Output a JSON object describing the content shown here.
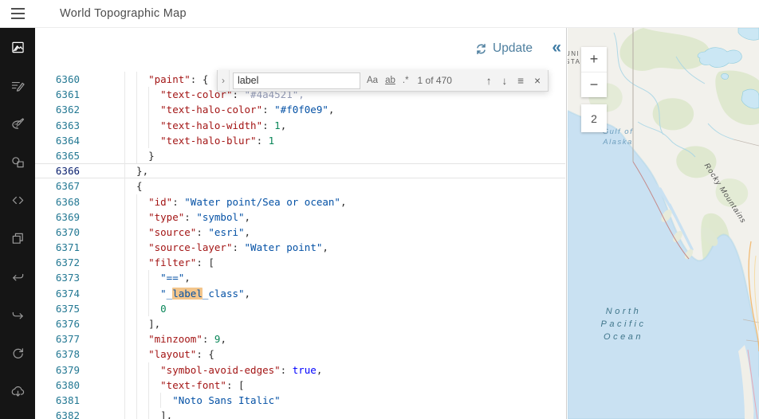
{
  "header": {
    "title": "World Topographic Map"
  },
  "sidebar": {
    "items": [
      {
        "icon": "layer-style-icon",
        "active": true
      },
      {
        "icon": "edit-labels-icon",
        "active": false
      },
      {
        "icon": "edit-colors-icon",
        "active": false
      },
      {
        "icon": "edit-symbols-icon",
        "active": false
      },
      {
        "icon": "edit-json-icon",
        "active": false
      },
      {
        "icon": "duplicate-icon",
        "active": false
      },
      {
        "icon": "undo-icon",
        "active": false
      },
      {
        "icon": "redo-icon",
        "active": false
      },
      {
        "icon": "reset-icon",
        "active": false
      },
      {
        "icon": "download-icon",
        "active": false
      }
    ]
  },
  "editor": {
    "toolbar": {
      "update_label": "Update",
      "collapse_icon": "«"
    },
    "find": {
      "expand_icon": "›",
      "query": "label",
      "match_case": "Aa",
      "whole_word": "ab",
      "regex": ".*",
      "results": "1 of 470",
      "prev_icon": "↑",
      "next_icon": "↓",
      "in_selection_icon": "≡",
      "close_icon": "×"
    },
    "code": {
      "current_line": 6366,
      "lines": [
        {
          "n": 6360,
          "tokens": [
            {
              "t": "    ",
              "c": "p"
            },
            {
              "t": "\"paint\"",
              "c": "k"
            },
            {
              "t": ": {",
              "c": "p"
            }
          ]
        },
        {
          "n": 6361,
          "tokens": [
            {
              "t": "      ",
              "c": "p"
            },
            {
              "t": "\"text-color\"",
              "c": "k"
            },
            {
              "t": ": ",
              "c": "p"
            },
            {
              "t": "\"#4a4521\",",
              "c": "d"
            }
          ]
        },
        {
          "n": 6362,
          "tokens": [
            {
              "t": "      ",
              "c": "p"
            },
            {
              "t": "\"text-halo-color\"",
              "c": "k"
            },
            {
              "t": ": ",
              "c": "p"
            },
            {
              "t": "\"#f0f0e9\"",
              "c": "s"
            },
            {
              "t": ",",
              "c": "p"
            }
          ]
        },
        {
          "n": 6363,
          "tokens": [
            {
              "t": "      ",
              "c": "p"
            },
            {
              "t": "\"text-halo-width\"",
              "c": "k"
            },
            {
              "t": ": ",
              "c": "p"
            },
            {
              "t": "1",
              "c": "n"
            },
            {
              "t": ",",
              "c": "p"
            }
          ]
        },
        {
          "n": 6364,
          "tokens": [
            {
              "t": "      ",
              "c": "p"
            },
            {
              "t": "\"text-halo-blur\"",
              "c": "k"
            },
            {
              "t": ": ",
              "c": "p"
            },
            {
              "t": "1",
              "c": "n"
            }
          ]
        },
        {
          "n": 6365,
          "tokens": [
            {
              "t": "    }",
              "c": "p"
            }
          ]
        },
        {
          "n": 6366,
          "tokens": [
            {
              "t": "  },",
              "c": "p"
            }
          ]
        },
        {
          "n": 6367,
          "tokens": [
            {
              "t": "  {",
              "c": "p"
            }
          ]
        },
        {
          "n": 6368,
          "tokens": [
            {
              "t": "    ",
              "c": "p"
            },
            {
              "t": "\"id\"",
              "c": "k"
            },
            {
              "t": ": ",
              "c": "p"
            },
            {
              "t": "\"Water point/Sea or ocean\"",
              "c": "s"
            },
            {
              "t": ",",
              "c": "p"
            }
          ]
        },
        {
          "n": 6369,
          "tokens": [
            {
              "t": "    ",
              "c": "p"
            },
            {
              "t": "\"type\"",
              "c": "k"
            },
            {
              "t": ": ",
              "c": "p"
            },
            {
              "t": "\"symbol\"",
              "c": "s"
            },
            {
              "t": ",",
              "c": "p"
            }
          ]
        },
        {
          "n": 6370,
          "tokens": [
            {
              "t": "    ",
              "c": "p"
            },
            {
              "t": "\"source\"",
              "c": "k"
            },
            {
              "t": ": ",
              "c": "p"
            },
            {
              "t": "\"esri\"",
              "c": "s"
            },
            {
              "t": ",",
              "c": "p"
            }
          ]
        },
        {
          "n": 6371,
          "tokens": [
            {
              "t": "    ",
              "c": "p"
            },
            {
              "t": "\"source-layer\"",
              "c": "k"
            },
            {
              "t": ": ",
              "c": "p"
            },
            {
              "t": "\"Water point\"",
              "c": "s"
            },
            {
              "t": ",",
              "c": "p"
            }
          ]
        },
        {
          "n": 6372,
          "tokens": [
            {
              "t": "    ",
              "c": "p"
            },
            {
              "t": "\"filter\"",
              "c": "k"
            },
            {
              "t": ": [",
              "c": "p"
            }
          ]
        },
        {
          "n": 6373,
          "tokens": [
            {
              "t": "      ",
              "c": "p"
            },
            {
              "t": "\"==\"",
              "c": "s"
            },
            {
              "t": ",",
              "c": "p"
            }
          ]
        },
        {
          "n": 6374,
          "tokens": [
            {
              "t": "      ",
              "c": "p"
            },
            {
              "t": "\"_",
              "c": "s"
            },
            {
              "t": "label",
              "c": "s",
              "h": true
            },
            {
              "t": "_class\"",
              "c": "s"
            },
            {
              "t": ",",
              "c": "p"
            }
          ]
        },
        {
          "n": 6375,
          "tokens": [
            {
              "t": "      ",
              "c": "p"
            },
            {
              "t": "0",
              "c": "n"
            }
          ]
        },
        {
          "n": 6376,
          "tokens": [
            {
              "t": "    ],",
              "c": "p"
            }
          ]
        },
        {
          "n": 6377,
          "tokens": [
            {
              "t": "    ",
              "c": "p"
            },
            {
              "t": "\"minzoom\"",
              "c": "k"
            },
            {
              "t": ": ",
              "c": "p"
            },
            {
              "t": "9",
              "c": "n"
            },
            {
              "t": ",",
              "c": "p"
            }
          ]
        },
        {
          "n": 6378,
          "tokens": [
            {
              "t": "    ",
              "c": "p"
            },
            {
              "t": "\"layout\"",
              "c": "k"
            },
            {
              "t": ": {",
              "c": "p"
            }
          ]
        },
        {
          "n": 6379,
          "tokens": [
            {
              "t": "      ",
              "c": "p"
            },
            {
              "t": "\"symbol-avoid-edges\"",
              "c": "k"
            },
            {
              "t": ": ",
              "c": "p"
            },
            {
              "t": "true",
              "c": "b"
            },
            {
              "t": ",",
              "c": "p"
            }
          ]
        },
        {
          "n": 6380,
          "tokens": [
            {
              "t": "      ",
              "c": "p"
            },
            {
              "t": "\"text-font\"",
              "c": "k"
            },
            {
              "t": ": [",
              "c": "p"
            }
          ]
        },
        {
          "n": 6381,
          "tokens": [
            {
              "t": "        ",
              "c": "p"
            },
            {
              "t": "\"Noto Sans Italic\"",
              "c": "s"
            }
          ]
        },
        {
          "n": 6382,
          "tokens": [
            {
              "t": "      ],",
              "c": "p"
            }
          ]
        }
      ]
    }
  },
  "map": {
    "controls": {
      "zoom_in": "+",
      "zoom_out": "−",
      "zoom_level": "2"
    },
    "labels": {
      "country_line1": "UNI",
      "country_line2": "STA",
      "gulf_line1": "Gulf of",
      "gulf_line2": "Alaska",
      "ocean_line1": "North",
      "ocean_line2": "Pacific",
      "ocean_line3": "Ocean",
      "mountains": "Rocky Mountains"
    }
  },
  "colors": {
    "accent_blue": "#4e7f9f",
    "syntax_key": "#a31515",
    "syntax_string": "#0451a5",
    "syntax_number": "#098658",
    "syntax_boolean": "#0000ff",
    "find_match_highlight": "#f3c58b",
    "ocean_fill": "#c9e1f2",
    "land_fill": "#f2f1ec"
  }
}
